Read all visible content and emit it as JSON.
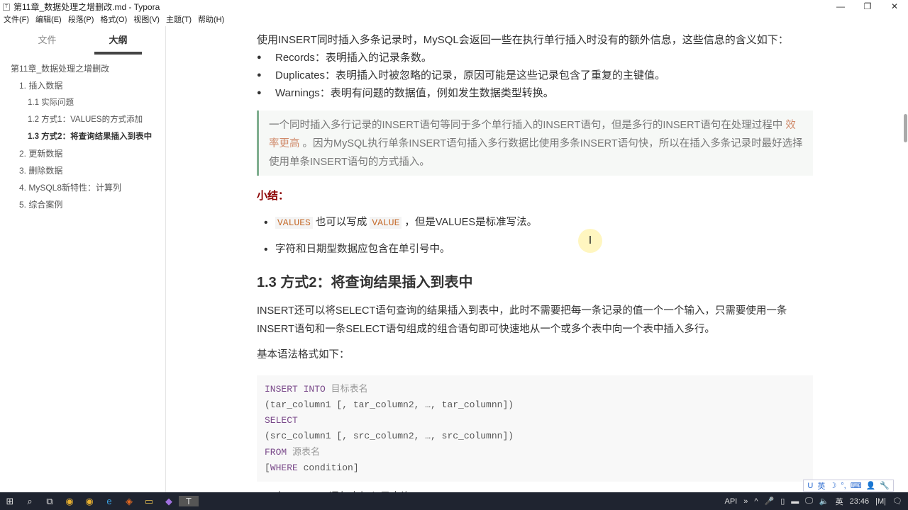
{
  "window": {
    "title": "第11章_数据处理之增删改.md - Typora",
    "app_icon": "T",
    "min": "—",
    "max": "❐",
    "close": "✕"
  },
  "menu": [
    "文件(F)",
    "编辑(E)",
    "段落(P)",
    "格式(O)",
    "视图(V)",
    "主题(T)",
    "帮助(H)"
  ],
  "sidebar": {
    "tabs": [
      "文件",
      "大纲"
    ],
    "active_tab": "大纲",
    "outline": [
      {
        "label": "第11章_数据处理之增删改",
        "level": 0
      },
      {
        "label": "1. 插入数据",
        "level": 1
      },
      {
        "label": "1.1 实际问题",
        "level": 2
      },
      {
        "label": "1.2 方式1：VALUES的方式添加",
        "level": 2
      },
      {
        "label": "1.3 方式2：将查询结果插入到表中",
        "level": 2,
        "current": true
      },
      {
        "label": "2. 更新数据",
        "level": 1
      },
      {
        "label": "3. 删除数据",
        "level": 1
      },
      {
        "label": "4. MySQL8新特性：计算列",
        "level": 1
      },
      {
        "label": "5. 综合案例",
        "level": 1
      }
    ],
    "footer": [
      "‹",
      "</>"
    ]
  },
  "content": {
    "intro": "使用INSERT同时插入多条记录时，MySQL会返回一些在执行单行插入时没有的额外信息，这些信息的含义如下：",
    "bullets": [
      "Records：表明插入的记录条数。",
      "Duplicates：表明插入时被忽略的记录，原因可能是这些记录包含了重复的主键值。",
      "Warnings：表明有问题的数据值，例如发生数据类型转换。"
    ],
    "quote": {
      "part1": "一个同时插入多行记录的INSERT语句等同于多个单行插入的INSERT语句，但是多行的INSERT语句在处理过程中 ",
      "highlight": "效率更高",
      "part2": " 。因为MySQL执行单条INSERT语句插入多行数据比使用多条INSERT语句快，所以在插入多条记录时最好选择使用单条INSERT语句的方式插入。"
    },
    "summary_title": "小结：",
    "summary": [
      {
        "code1": "VALUES",
        "t1": " 也可以写成 ",
        "code2": "VALUE",
        "t2": " ，但是VALUES是标准写法。"
      },
      {
        "text": "字符和日期型数据应包含在单引号中。"
      }
    ],
    "heading": "1.3 方式2：将查询结果插入到表中",
    "para": "INSERT还可以将SELECT语句查询的结果插入到表中，此时不需要把每一条记录的值一个一个输入，只需要使用一条INSERT语句和一条SELECT语句组成的组合语句即可快速地从一个或多个表中向一个表中插入多行。",
    "syntax_label": "基本语法格式如下：",
    "code": [
      {
        "kw": "INSERT INTO",
        "rest": " ",
        "cm": "目标表名"
      },
      {
        "rest": "(tar_column1 [, tar_column2, …, tar_columnn])"
      },
      {
        "kw": "SELECT"
      },
      {
        "rest": "(src_column1 [, src_column2, …, src_columnn])"
      },
      {
        "kw": "FROM",
        "rest": " ",
        "cm": "源表名"
      },
      {
        "rest": "[",
        "kw": "WHERE",
        "rest2": " condition]"
      }
    ],
    "cut_item": "在 INSERT 语句中加入子查询。"
  },
  "cursor": "I",
  "ime": [
    "U",
    "英",
    "☽",
    "°,",
    "⌨",
    "👤",
    "🔧"
  ],
  "taskbar": {
    "icons": [
      "⊞",
      "⌕",
      "⧉",
      "◉",
      "◉",
      "e",
      "◈",
      "▭",
      "◆",
      "T"
    ],
    "tray": [
      "API",
      "»",
      "^",
      "🎤",
      "▯",
      "▬",
      "🖵",
      "🔈",
      "英",
      "23:46",
      "|M|",
      "🗨"
    ]
  }
}
